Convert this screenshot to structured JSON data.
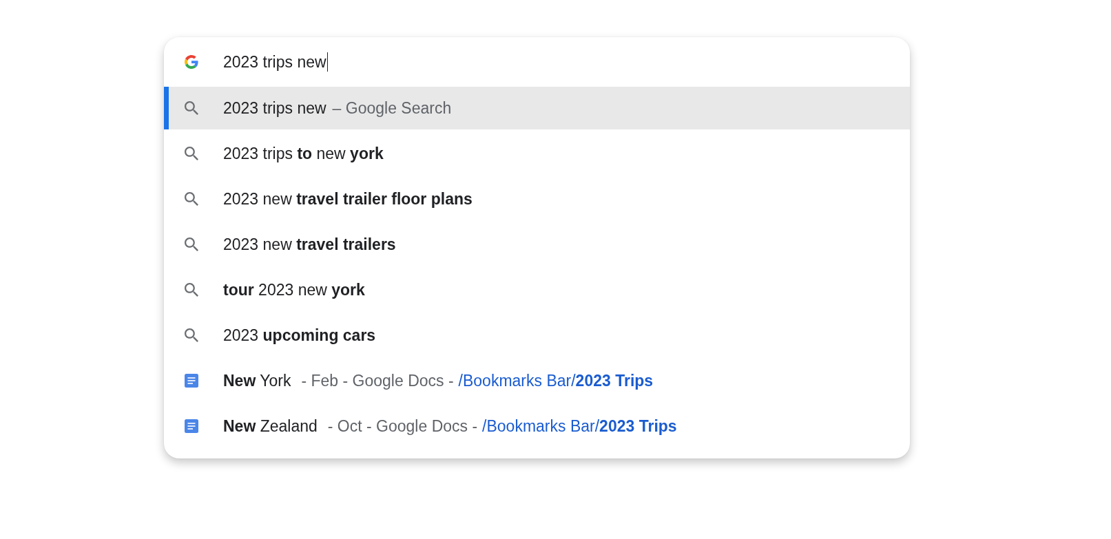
{
  "omnibox": {
    "value": "2023 trips new",
    "focused": true
  },
  "suggestions": [
    {
      "kind": "search",
      "selected": true,
      "text": "2023 trips new",
      "description": "– Google Search"
    },
    {
      "kind": "search",
      "selected": false,
      "text": "2023 trips **to** new **york**"
    },
    {
      "kind": "search",
      "selected": false,
      "text": "2023 new **travel trailer floor plans**"
    },
    {
      "kind": "search",
      "selected": false,
      "text": "2023 new **travel trailers**"
    },
    {
      "kind": "search",
      "selected": false,
      "text": "**tour** 2023 new **york**"
    },
    {
      "kind": "search",
      "selected": false,
      "text": "2023 **upcoming cars**"
    },
    {
      "kind": "document",
      "selected": false,
      "text": "**New** York",
      "description": "- Feb - Google Docs -",
      "path": "/Bookmarks Bar/**2023 Trips**"
    },
    {
      "kind": "document",
      "selected": false,
      "text": "**New** Zealand",
      "description": "- Oct - Google Docs -",
      "path": "/Bookmarks Bar/**2023 Trips**"
    }
  ]
}
